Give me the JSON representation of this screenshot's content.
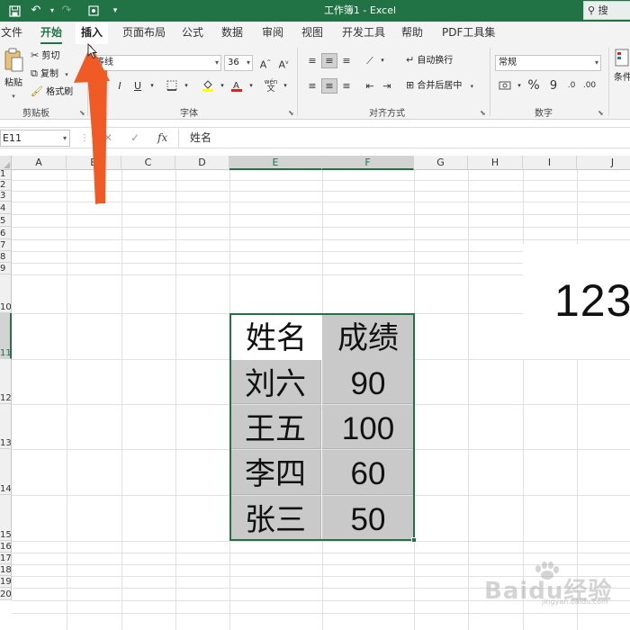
{
  "titlebar": {
    "title": "工作簿1 - Excel",
    "search_label": "搜",
    "save_icon": "save-icon",
    "undo_icon": "undo-icon",
    "redo_icon": "redo-icon"
  },
  "tabs": [
    "文件",
    "开始",
    "插入",
    "页面布局",
    "公式",
    "数据",
    "审阅",
    "视图",
    "开发工具",
    "帮助",
    "PDF工具集"
  ],
  "ribbon": {
    "clipboard": {
      "paste": "粘贴",
      "cut": "剪切",
      "copy": "复制",
      "format_painter": "格式刷",
      "label": "剪贴板"
    },
    "font": {
      "name": "等线",
      "size": "36",
      "bold": "B",
      "italic": "I",
      "underline": "U",
      "wen": "wén",
      "label": "字体"
    },
    "alignment": {
      "wrap": "自动换行",
      "merge": "合并后居中",
      "label": "对齐方式"
    },
    "number": {
      "format": "常规",
      "percent": "%",
      "comma": "9",
      "label": "数字"
    },
    "conditional": "条件"
  },
  "formula_bar": {
    "name_box": "E11",
    "fx": "fx",
    "cancel": "✕",
    "enter": "✓",
    "content": "姓名"
  },
  "sheet": {
    "columns": [
      "A",
      "B",
      "C",
      "D",
      "E",
      "F",
      "G",
      "H",
      "I",
      "J"
    ],
    "selected_columns": [
      "E",
      "F"
    ],
    "row_labels": [
      "1",
      "2",
      "3",
      "4",
      "5",
      "6",
      "7",
      "8",
      "9",
      "10",
      "11",
      "12",
      "13",
      "14",
      "15",
      "16",
      "17",
      "18",
      "19",
      "20"
    ],
    "table": {
      "header": [
        "姓名",
        "成绩"
      ],
      "rows": [
        [
          "刘六",
          "90"
        ],
        [
          "王五",
          "100"
        ],
        [
          "李四",
          "60"
        ],
        [
          "张三",
          "50"
        ]
      ]
    },
    "stray_value": "123"
  },
  "watermark": {
    "text": "Baidu经验",
    "url": "jingyan.baidu.com"
  },
  "colors": {
    "excel_green": "#217346",
    "arrow": "#f05a24",
    "cell_fill": "#c9c9c9"
  }
}
